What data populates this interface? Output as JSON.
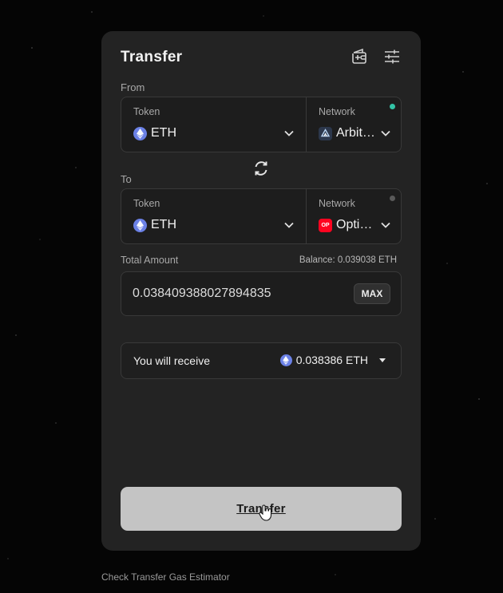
{
  "card": {
    "title": "Transfer",
    "icons": [
      "wallet-add-icon",
      "sliders-icon"
    ]
  },
  "from": {
    "label": "From",
    "token_label": "Token",
    "token": "ETH",
    "network_label": "Network",
    "network": "Arbit…",
    "status_color": "#33c3a6"
  },
  "to": {
    "label": "To",
    "token_label": "Token",
    "token": "ETH",
    "network_label": "Network",
    "network": "Opti…",
    "network_badge": "OP",
    "status_color": "#5a5a5a"
  },
  "amount": {
    "label": "Total Amount",
    "balance": "Balance: 0.039038 ETH",
    "value": "0.038409388027894835",
    "max_label": "MAX"
  },
  "receive": {
    "label": "You will receive",
    "amount": "0.038386 ETH"
  },
  "submit_label": "Transfer",
  "footer_link": "Check Transfer Gas Estimator",
  "colors": {
    "card_bg": "#232323",
    "eth_coin": "#6b81e6",
    "optimism_badge": "#ff0420",
    "button_bg": "#c4c4c4"
  }
}
